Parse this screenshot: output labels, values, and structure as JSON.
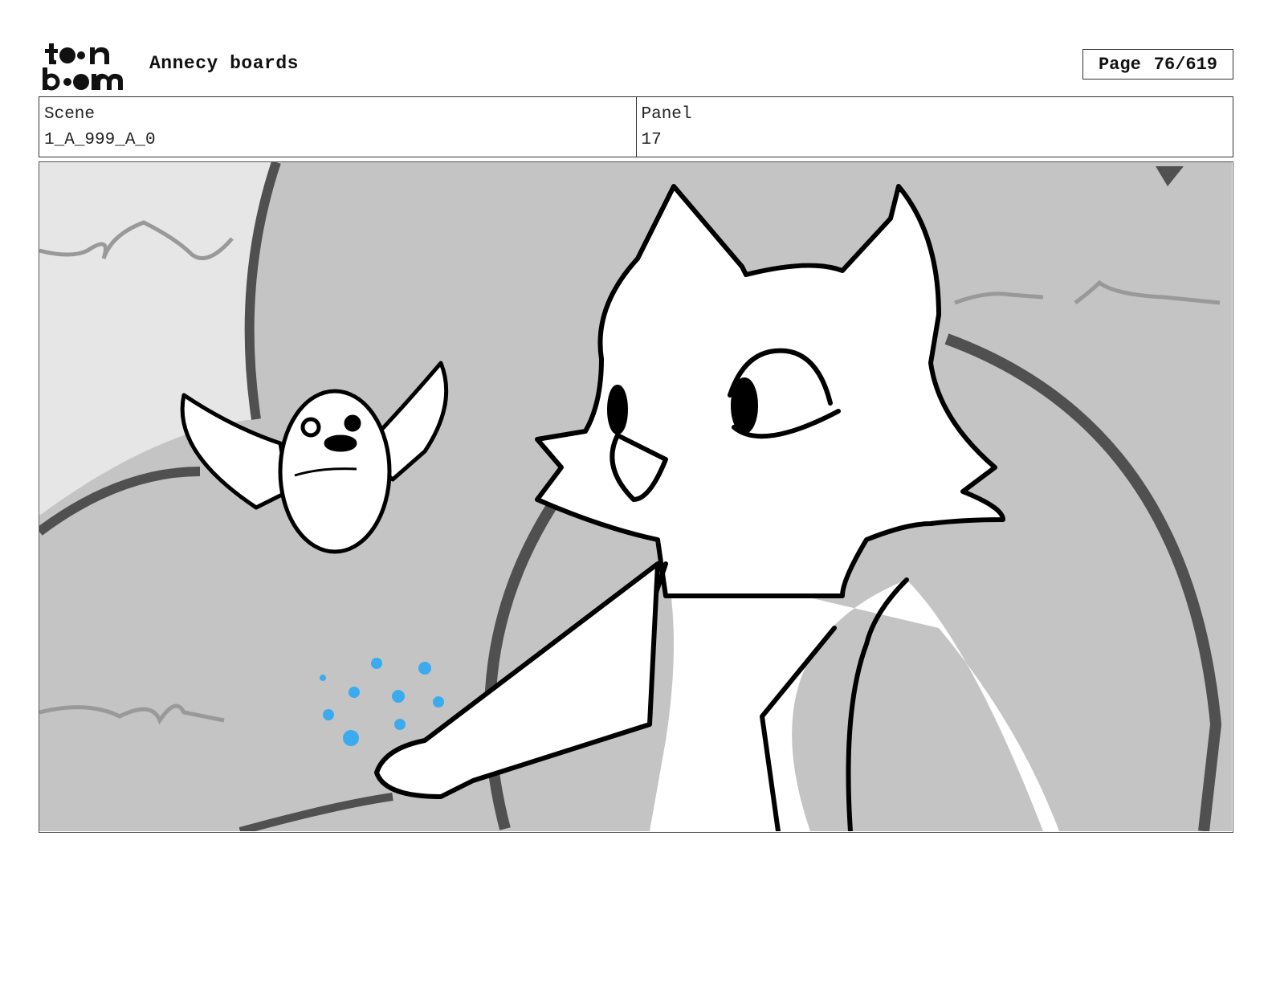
{
  "header": {
    "logo": {
      "text_top": "toon",
      "text_bottom": "boom"
    },
    "title": "Annecy boards",
    "page_label": "Page",
    "page_number": "76/619"
  },
  "info": {
    "scene_label": "Scene",
    "scene_value": "1_A_999_A_0",
    "panel_label": "Panel",
    "panel_value": "17"
  },
  "panel_image": {
    "subject": "fox-sketch-with-bird-and-blue-seeds",
    "colors": {
      "sky_light": "#e6e6e6",
      "background": "#c4c4c4",
      "line_dark": "#505050",
      "ink": "#000000",
      "fill": "#ffffff",
      "seeds": "#3aabee"
    }
  }
}
